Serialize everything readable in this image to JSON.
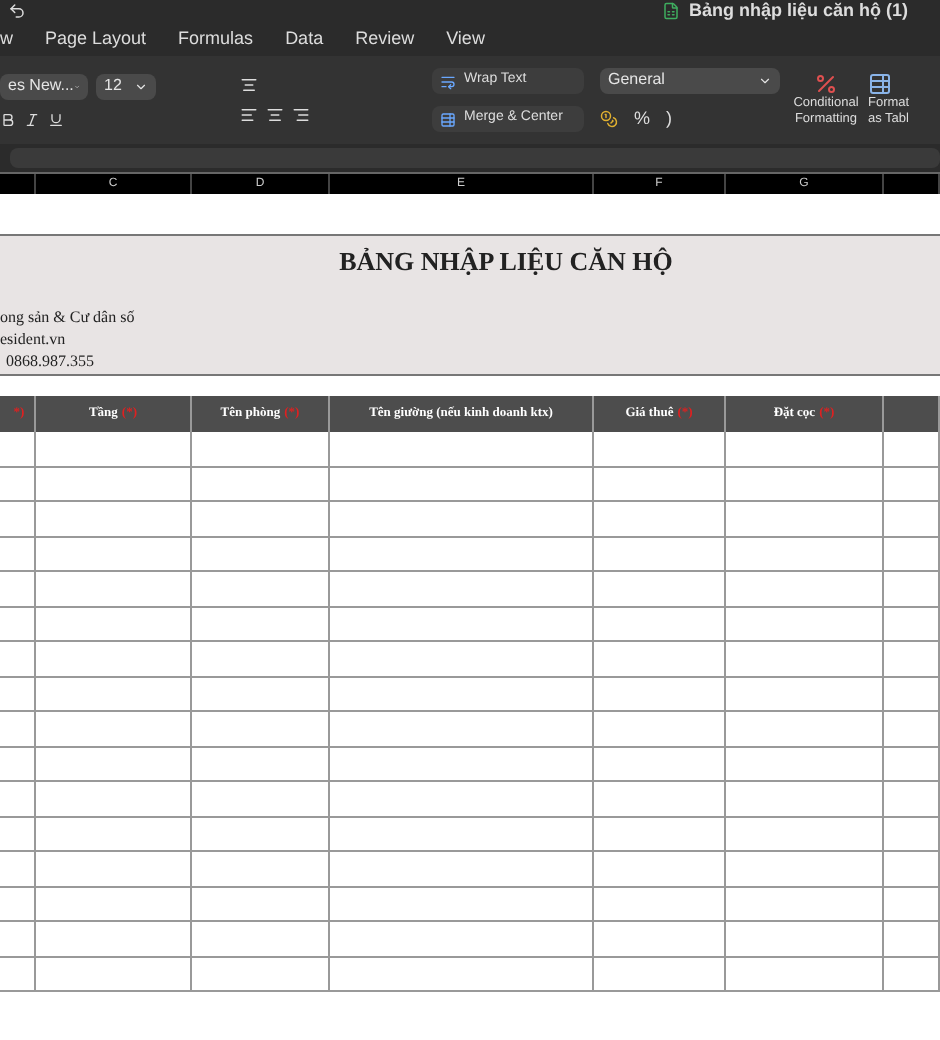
{
  "window": {
    "title": "Bảng nhập liệu căn hộ (1)"
  },
  "tabs": [
    {
      "label": "w",
      "selected": false
    },
    {
      "label": "Page Layout",
      "selected": false
    },
    {
      "label": "Formulas",
      "selected": false
    },
    {
      "label": "Data",
      "selected": false
    },
    {
      "label": "Review",
      "selected": false
    },
    {
      "label": "View",
      "selected": false
    }
  ],
  "ribbon": {
    "font_name": "es New...",
    "font_size": "12",
    "wrap_text": "Wrap Text",
    "merge_center": "Merge & Center",
    "number_format": "General",
    "percent": "%",
    "comma": ")",
    "conditional_formatting": "Conditional Formatting",
    "format_as_table": "Format as Tabl"
  },
  "column_letters": [
    "C",
    "D",
    "E",
    "F",
    "G"
  ],
  "banner": {
    "title": "BẢNG NHẬP LIỆU CĂN HỘ",
    "lines": [
      "ong sản & Cư dân số",
      "esident.vn",
      "0868.987.355"
    ]
  },
  "table": {
    "columns": [
      {
        "required_mark": "*)"
      },
      {
        "label": "Tầng",
        "required_mark": "(*)"
      },
      {
        "label": "Tên phòng",
        "required_mark": "(*)"
      },
      {
        "label": "Tên giường (nếu kinh doanh ktx)"
      },
      {
        "label": "Giá thuê",
        "required_mark": "(*)"
      },
      {
        "label": "Đặt cọc",
        "required_mark": "(*)"
      },
      {}
    ]
  }
}
